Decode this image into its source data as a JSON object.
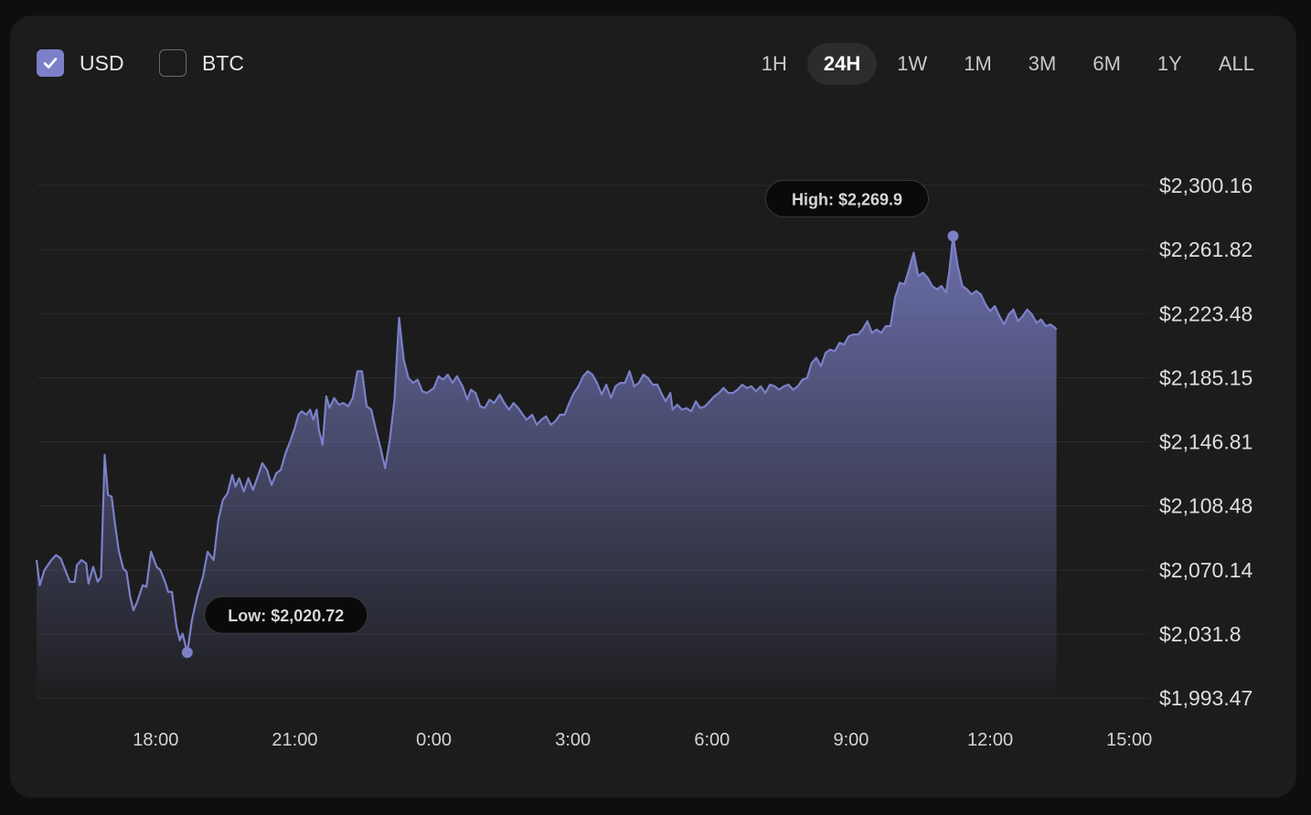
{
  "currency_toggle": [
    {
      "label": "USD",
      "checked": true
    },
    {
      "label": "BTC",
      "checked": false
    }
  ],
  "time_ranges": [
    "1H",
    "24H",
    "1W",
    "1M",
    "3M",
    "6M",
    "1Y",
    "ALL"
  ],
  "selected_range": "24H",
  "colors": {
    "accent": "#7b80c8",
    "background": "#1c1c1c",
    "gridline": "#2a2a2a",
    "callout_bg": "#0a0a0a"
  },
  "chart_data": {
    "type": "area",
    "x_tick_labels": [
      "18:00",
      "21:00",
      "0:00",
      "3:00",
      "6:00",
      "9:00",
      "12:00",
      "15:00"
    ],
    "y_tick_labels": [
      "$2,300.16",
      "$2,261.82",
      "$2,223.48",
      "$2,185.15",
      "$2,146.81",
      "$2,108.48",
      "$2,070.14",
      "$2,031.8",
      "$1,993.47"
    ],
    "y_ticks": [
      2300.16,
      2261.82,
      2223.48,
      2185.15,
      2146.81,
      2108.48,
      2070.14,
      2031.8,
      1993.47
    ],
    "ylim": [
      1993.47,
      2300.16
    ],
    "x_unit": "hours",
    "x_tick_positions": [
      18,
      21,
      24,
      27,
      30,
      33,
      36,
      39
    ],
    "xlim": [
      15.43,
      39.43
    ],
    "grid": true,
    "high_label": "High: $2,269.9",
    "low_label": "Low: $2,020.72",
    "high": {
      "x": 36.57,
      "y": 2269.9
    },
    "low": {
      "x": 18.68,
      "y": 2020.72
    },
    "points": [
      [
        15.43,
        2076
      ],
      [
        15.5,
        2061
      ],
      [
        15.6,
        2070
      ],
      [
        15.75,
        2076
      ],
      [
        15.85,
        2079
      ],
      [
        15.95,
        2077
      ],
      [
        16.05,
        2070
      ],
      [
        16.15,
        2063
      ],
      [
        16.25,
        2063
      ],
      [
        16.3,
        2073
      ],
      [
        16.4,
        2076
      ],
      [
        16.5,
        2074
      ],
      [
        16.55,
        2062
      ],
      [
        16.65,
        2072
      ],
      [
        16.75,
        2063
      ],
      [
        16.82,
        2066
      ],
      [
        16.9,
        2139
      ],
      [
        16.97,
        2115
      ],
      [
        17.05,
        2114
      ],
      [
        17.12,
        2098
      ],
      [
        17.2,
        2082
      ],
      [
        17.3,
        2071
      ],
      [
        17.37,
        2069
      ],
      [
        17.45,
        2054
      ],
      [
        17.52,
        2046
      ],
      [
        17.6,
        2051
      ],
      [
        17.72,
        2061
      ],
      [
        17.8,
        2060
      ],
      [
        17.9,
        2081
      ],
      [
        18.02,
        2072
      ],
      [
        18.1,
        2070
      ],
      [
        18.2,
        2063
      ],
      [
        18.27,
        2057
      ],
      [
        18.35,
        2057
      ],
      [
        18.45,
        2036
      ],
      [
        18.52,
        2028
      ],
      [
        18.58,
        2032
      ],
      [
        18.68,
        2020.72
      ],
      [
        18.78,
        2040
      ],
      [
        18.9,
        2055
      ],
      [
        19.02,
        2066
      ],
      [
        19.12,
        2081
      ],
      [
        19.25,
        2076
      ],
      [
        19.35,
        2100
      ],
      [
        19.45,
        2112
      ],
      [
        19.55,
        2116
      ],
      [
        19.65,
        2127
      ],
      [
        19.72,
        2120
      ],
      [
        19.8,
        2125
      ],
      [
        19.9,
        2117
      ],
      [
        20.0,
        2125
      ],
      [
        20.1,
        2118
      ],
      [
        20.2,
        2126
      ],
      [
        20.3,
        2134
      ],
      [
        20.4,
        2130
      ],
      [
        20.5,
        2121
      ],
      [
        20.6,
        2128
      ],
      [
        20.7,
        2130
      ],
      [
        20.8,
        2140
      ],
      [
        20.9,
        2147
      ],
      [
        21.0,
        2155
      ],
      [
        21.08,
        2163
      ],
      [
        21.15,
        2165
      ],
      [
        21.25,
        2163
      ],
      [
        21.33,
        2166
      ],
      [
        21.4,
        2160
      ],
      [
        21.47,
        2166
      ],
      [
        21.52,
        2154
      ],
      [
        21.6,
        2145
      ],
      [
        21.68,
        2174
      ],
      [
        21.75,
        2167
      ],
      [
        21.85,
        2173
      ],
      [
        21.95,
        2169
      ],
      [
        22.05,
        2170
      ],
      [
        22.15,
        2168
      ],
      [
        22.25,
        2173
      ],
      [
        22.35,
        2189
      ],
      [
        22.45,
        2189
      ],
      [
        22.55,
        2168
      ],
      [
        22.65,
        2166
      ],
      [
        22.75,
        2154
      ],
      [
        22.85,
        2143
      ],
      [
        22.95,
        2131
      ],
      [
        23.05,
        2148
      ],
      [
        23.15,
        2172
      ],
      [
        23.25,
        2221
      ],
      [
        23.35,
        2196
      ],
      [
        23.45,
        2185
      ],
      [
        23.55,
        2182
      ],
      [
        23.65,
        2184
      ],
      [
        23.75,
        2177
      ],
      [
        23.85,
        2176
      ],
      [
        24.0,
        2179
      ],
      [
        24.1,
        2186
      ],
      [
        24.2,
        2184
      ],
      [
        24.3,
        2187
      ],
      [
        24.4,
        2182
      ],
      [
        24.5,
        2186
      ],
      [
        24.62,
        2180
      ],
      [
        24.72,
        2172
      ],
      [
        24.8,
        2178
      ],
      [
        24.9,
        2176
      ],
      [
        25.0,
        2168
      ],
      [
        25.1,
        2167
      ],
      [
        25.2,
        2172
      ],
      [
        25.3,
        2170
      ],
      [
        25.42,
        2175
      ],
      [
        25.52,
        2170
      ],
      [
        25.62,
        2166
      ],
      [
        25.72,
        2170
      ],
      [
        25.82,
        2167
      ],
      [
        25.92,
        2163
      ],
      [
        26.0,
        2160
      ],
      [
        26.12,
        2163
      ],
      [
        26.22,
        2157
      ],
      [
        26.32,
        2160
      ],
      [
        26.42,
        2162
      ],
      [
        26.52,
        2157
      ],
      [
        26.62,
        2159
      ],
      [
        26.72,
        2163
      ],
      [
        26.82,
        2163
      ],
      [
        26.92,
        2170
      ],
      [
        27.02,
        2176
      ],
      [
        27.12,
        2180
      ],
      [
        27.22,
        2186
      ],
      [
        27.32,
        2189
      ],
      [
        27.42,
        2187
      ],
      [
        27.52,
        2182
      ],
      [
        27.62,
        2175
      ],
      [
        27.72,
        2181
      ],
      [
        27.82,
        2173
      ],
      [
        27.92,
        2180
      ],
      [
        28.02,
        2182
      ],
      [
        28.12,
        2182
      ],
      [
        28.22,
        2189
      ],
      [
        28.32,
        2180
      ],
      [
        28.42,
        2182
      ],
      [
        28.52,
        2187
      ],
      [
        28.62,
        2185
      ],
      [
        28.72,
        2181
      ],
      [
        28.82,
        2181
      ],
      [
        28.92,
        2175
      ],
      [
        29.0,
        2171
      ],
      [
        29.1,
        2176
      ],
      [
        29.15,
        2166
      ],
      [
        29.25,
        2169
      ],
      [
        29.35,
        2166
      ],
      [
        29.45,
        2167
      ],
      [
        29.55,
        2165
      ],
      [
        29.65,
        2171
      ],
      [
        29.75,
        2167
      ],
      [
        29.85,
        2168
      ],
      [
        29.95,
        2171
      ],
      [
        30.05,
        2174
      ],
      [
        30.15,
        2176
      ],
      [
        30.25,
        2179
      ],
      [
        30.35,
        2176
      ],
      [
        30.45,
        2176
      ],
      [
        30.55,
        2178
      ],
      [
        30.65,
        2181
      ],
      [
        30.75,
        2179
      ],
      [
        30.85,
        2180
      ],
      [
        30.95,
        2177
      ],
      [
        31.05,
        2180
      ],
      [
        31.15,
        2176
      ],
      [
        31.25,
        2181
      ],
      [
        31.35,
        2180
      ],
      [
        31.45,
        2178
      ],
      [
        31.55,
        2180
      ],
      [
        31.65,
        2181
      ],
      [
        31.75,
        2178
      ],
      [
        31.85,
        2180
      ],
      [
        31.95,
        2184
      ],
      [
        32.05,
        2185
      ],
      [
        32.15,
        2194
      ],
      [
        32.25,
        2197
      ],
      [
        32.35,
        2192
      ],
      [
        32.45,
        2200
      ],
      [
        32.55,
        2202
      ],
      [
        32.65,
        2201
      ],
      [
        32.75,
        2206
      ],
      [
        32.85,
        2205
      ],
      [
        32.95,
        2210
      ],
      [
        33.05,
        2211
      ],
      [
        33.15,
        2211
      ],
      [
        33.25,
        2214
      ],
      [
        33.35,
        2219
      ],
      [
        33.45,
        2212
      ],
      [
        33.55,
        2214
      ],
      [
        33.65,
        2212
      ],
      [
        33.75,
        2216
      ],
      [
        33.85,
        2216
      ],
      [
        33.95,
        2233
      ],
      [
        34.05,
        2242
      ],
      [
        34.15,
        2241
      ],
      [
        34.25,
        2250
      ],
      [
        34.35,
        2260
      ],
      [
        34.45,
        2246
      ],
      [
        34.55,
        2248
      ],
      [
        34.65,
        2245
      ],
      [
        34.75,
        2240
      ],
      [
        34.85,
        2238
      ],
      [
        34.95,
        2240
      ],
      [
        35.05,
        2236
      ],
      [
        35.12,
        2249
      ],
      [
        35.2,
        2269.9
      ],
      [
        35.3,
        2252
      ],
      [
        35.4,
        2240
      ],
      [
        35.5,
        2238
      ],
      [
        35.6,
        2235
      ],
      [
        35.7,
        2237
      ],
      [
        35.8,
        2235
      ],
      [
        35.9,
        2229
      ],
      [
        36.0,
        2225
      ],
      [
        36.1,
        2228
      ],
      [
        36.2,
        2222
      ],
      [
        36.3,
        2217
      ],
      [
        36.4,
        2223
      ],
      [
        36.5,
        2226
      ],
      [
        36.6,
        2219
      ],
      [
        36.7,
        2222
      ],
      [
        36.8,
        2226
      ],
      [
        36.9,
        2223
      ],
      [
        37.0,
        2218
      ],
      [
        37.1,
        2220
      ],
      [
        37.2,
        2216
      ],
      [
        37.3,
        2217
      ],
      [
        37.4,
        2215
      ],
      [
        37.43,
        2214
      ]
    ]
  }
}
